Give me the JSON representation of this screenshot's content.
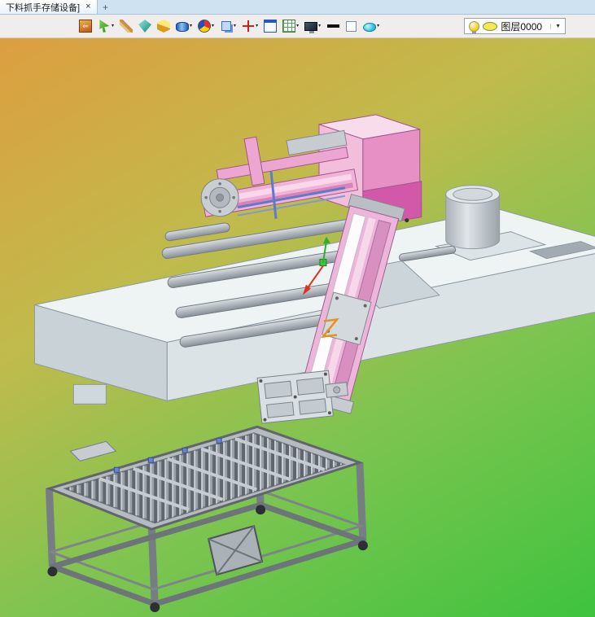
{
  "window": {
    "tab": {
      "title": "下料抓手存储设备]",
      "close_glyph": "×",
      "new_tab_glyph": "+"
    },
    "toolbar": {
      "dropdown_glyph": "▾",
      "icons": [
        {
          "name": "exit-icon",
          "dropdown": false
        },
        {
          "name": "select-arrow-icon",
          "dropdown": true
        },
        {
          "name": "sketch-pencil-icon",
          "dropdown": false
        },
        {
          "name": "part-gem-icon",
          "dropdown": false
        },
        {
          "name": "solid-cube-icon",
          "dropdown": false
        },
        {
          "name": "feature-cylinder-icon",
          "dropdown": true
        },
        {
          "name": "color-wheel-icon",
          "dropdown": true
        },
        {
          "name": "copy-paste-icon",
          "dropdown": true
        },
        {
          "name": "move-axis-icon",
          "dropdown": true
        },
        {
          "name": "view-window-icon",
          "dropdown": false
        },
        {
          "name": "grid-table-icon",
          "dropdown": true
        },
        {
          "name": "display-monitor-icon",
          "dropdown": true
        },
        {
          "name": "line-width-icon",
          "dropdown": false
        },
        {
          "name": "blank-swatch-icon",
          "dropdown": false
        },
        {
          "name": "surface-blob-icon",
          "dropdown": true
        }
      ],
      "layer_selector": {
        "label": "图层0000",
        "swatch_color": "#f2ea4e",
        "dropdown_glyph": "▼"
      }
    }
  },
  "viewport": {
    "background": {
      "top_left": "#dd9e40",
      "mid": "#c0bb4c",
      "lower_mid": "#7ec450",
      "bottom": "#3ec33e"
    }
  }
}
